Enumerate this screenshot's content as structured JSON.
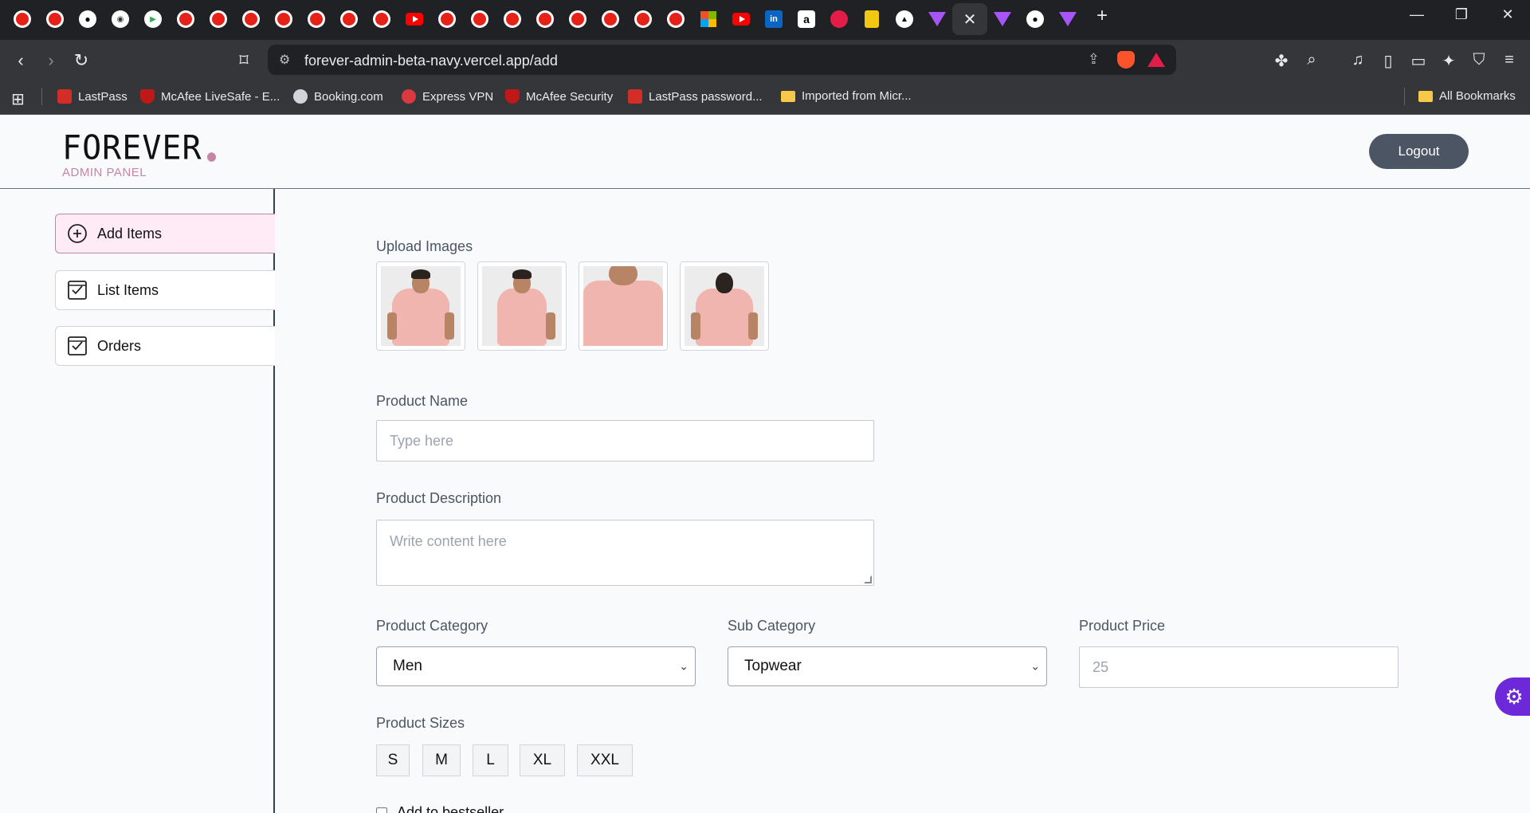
{
  "browser": {
    "tabs": [
      "yt-round",
      "yt-round",
      "gh",
      "hat",
      "play",
      "yt-round",
      "yt-round",
      "yt-round",
      "yt-round",
      "yt-round",
      "yt-round",
      "yt-round",
      "yt-rect",
      "yt-round",
      "yt-round",
      "yt-round",
      "yt-round",
      "yt-round",
      "yt-round",
      "yt-round",
      "yt-round",
      "ms",
      "yt-rect",
      "li",
      "amz",
      "red",
      "pbi",
      "tri",
      "vee",
      "active",
      "vee",
      "gh",
      "vee"
    ],
    "url": "forever-admin-beta-navy.vercel.app/add",
    "bookmarks": [
      {
        "label": "LastPass",
        "icon": "lastpass-icon"
      },
      {
        "label": "McAfee LiveSafe - E...",
        "icon": "mcafee-icon"
      },
      {
        "label": "Booking.com",
        "icon": "booking-icon"
      },
      {
        "label": "Express VPN",
        "icon": "expressvpn-icon"
      },
      {
        "label": "McAfee Security",
        "icon": "mcafee-icon"
      },
      {
        "label": "LastPass password...",
        "icon": "lastpass-icon"
      },
      {
        "label": "Imported from Micr...",
        "icon": "folder-icon"
      }
    ],
    "all_bookmarks": "All Bookmarks"
  },
  "header": {
    "logo_text": "FOREVER",
    "logo_subtitle": "ADMIN PANEL",
    "logout_label": "Logout",
    "accent": "#c586a5"
  },
  "sidebar": {
    "items": [
      {
        "label": "Add Items",
        "icon": "plus-circle-icon",
        "active": true
      },
      {
        "label": "List Items",
        "icon": "check-square-icon",
        "active": false
      },
      {
        "label": "Orders",
        "icon": "check-square-icon",
        "active": false
      }
    ]
  },
  "form": {
    "upload_label": "Upload Images",
    "name_label": "Product Name",
    "name_placeholder": "Type here",
    "description_label": "Product Description",
    "description_placeholder": "Write content here",
    "category_label": "Product Category",
    "category_value": "Men",
    "subcategory_label": "Sub Category",
    "subcategory_value": "Topwear",
    "price_label": "Product Price",
    "price_value": "25",
    "sizes_label": "Product Sizes",
    "sizes": [
      "S",
      "M",
      "L",
      "XL",
      "XXL"
    ],
    "bestseller_label": "Add to bestseller"
  }
}
